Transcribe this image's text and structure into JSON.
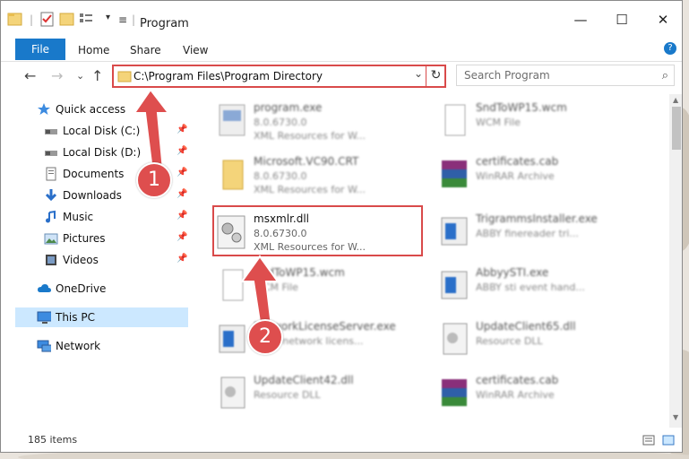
{
  "window": {
    "title": "Program",
    "minimize_glyph": "—",
    "maximize_glyph": "☐",
    "close_glyph": "✕"
  },
  "ribbon": {
    "tabs": [
      "File",
      "Home",
      "Share",
      "View"
    ],
    "help_glyph": "?"
  },
  "address": {
    "path": "C:\\Program Files\\Program Directory",
    "refresh_glyph": "↻",
    "dropdown_glyph": "⌄"
  },
  "search": {
    "placeholder": "Search Program"
  },
  "nav": {
    "back_glyph": "←",
    "forward_glyph": "→",
    "recent_glyph": "⌄",
    "up_glyph": "↑"
  },
  "sidebar": {
    "items": [
      {
        "label": "Quick access",
        "icon": "star-icon",
        "pinned": false
      },
      {
        "label": "Local Disk (C:)",
        "icon": "drive-icon",
        "pinned": true
      },
      {
        "label": "Local Disk (D:)",
        "icon": "drive-icon",
        "pinned": true
      },
      {
        "label": "Documents",
        "icon": "documents-icon",
        "pinned": true
      },
      {
        "label": "Downloads",
        "icon": "download-icon",
        "pinned": true
      },
      {
        "label": "Music",
        "icon": "music-icon",
        "pinned": true
      },
      {
        "label": "Pictures",
        "icon": "pictures-icon",
        "pinned": true
      },
      {
        "label": "Videos",
        "icon": "videos-icon",
        "pinned": true
      },
      {
        "label": "OneDrive",
        "icon": "cloud-icon",
        "pinned": false
      },
      {
        "label": "This PC",
        "icon": "computer-icon",
        "pinned": false,
        "selected": true
      },
      {
        "label": "Network",
        "icon": "network-icon",
        "pinned": false
      }
    ],
    "pin_glyph": "📌"
  },
  "files": [
    {
      "name": "program.exe",
      "sub1": "8.0.6730.0",
      "sub2": "XML Resources for W..."
    },
    {
      "name": "SndToWP15.wcm",
      "sub1": "WCM File",
      "sub2": ""
    },
    {
      "name": "Microsoft.VC90.CRT",
      "sub1": "8.0.6730.0",
      "sub2": "XML Resources for W..."
    },
    {
      "name": "certificates.cab",
      "sub1": "WinRAR Archive",
      "sub2": ""
    },
    {
      "name": "msxmlr.dll",
      "sub1": "8.0.6730.0",
      "sub2": "XML Resources for W...",
      "highlight": true
    },
    {
      "name": "TrigrammsInstaller.exe",
      "sub1": "ABBY finereader tri...",
      "sub2": ""
    },
    {
      "name": "SndToWP15.wcm",
      "sub1": "WCM File",
      "sub2": ""
    },
    {
      "name": "AbbyySTI.exe",
      "sub1": "ABBY sti event hand...",
      "sub2": ""
    },
    {
      "name": "NetworkLicenseServer.exe",
      "sub1": "ABBY network licens...",
      "sub2": ""
    },
    {
      "name": "UpdateClient65.dll",
      "sub1": "Resource DLL",
      "sub2": ""
    },
    {
      "name": "UpdateClient42.dll",
      "sub1": "Resource DLL",
      "sub2": ""
    },
    {
      "name": "certificates.cab",
      "sub1": "WinRAR Archive",
      "sub2": ""
    }
  ],
  "status": {
    "count": "185 items"
  },
  "callouts": [
    "1",
    "2"
  ],
  "colors": {
    "accent": "#1979ca",
    "highlight_red": "#d94a4a",
    "selection": "#cce8ff"
  }
}
